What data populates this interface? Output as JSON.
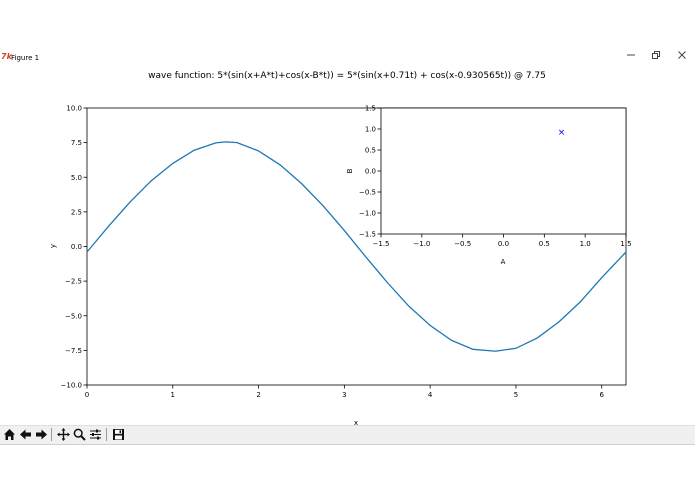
{
  "window": {
    "title": "Figure 1",
    "app_icon": "7k"
  },
  "main_chart": {
    "title": "wave function: 5*(sin(x+A*t)+cos(x-B*t)) = 5*(sin(x+0.71t) + cos(x-0.930565t)) @ 7.75",
    "xlabel": "x",
    "ylabel": "y",
    "x_ticks": [
      "0",
      "1",
      "2",
      "3",
      "4",
      "5",
      "6"
    ],
    "y_ticks": [
      "10.0",
      "7.5",
      "5.0",
      "2.5",
      "0.0",
      "−2.5",
      "−5.0",
      "−7.5",
      "−10.0"
    ]
  },
  "inset_chart": {
    "xlabel": "A",
    "ylabel": "B",
    "x_ticks": [
      "−1.5",
      "−1.0",
      "−0.5",
      "0.0",
      "0.5",
      "1.0",
      "1.5"
    ],
    "y_ticks": [
      "1.5",
      "1.0",
      "0.5",
      "0.0",
      "−0.5",
      "−1.0",
      "−1.5"
    ],
    "marker": "×"
  },
  "chart_data": [
    {
      "type": "line",
      "title": "wave function: 5*(sin(x+A*t)+cos(x-B*t)) = 5*(sin(x+0.71t) + cos(x-0.930565t)) @ 7.75",
      "xlabel": "x",
      "ylabel": "y",
      "xlim": [
        0,
        6.283
      ],
      "ylim": [
        -10,
        10
      ],
      "grid": false,
      "line_color": "#1f77b4",
      "x": [
        0.0,
        0.25,
        0.5,
        0.75,
        1.0,
        1.25,
        1.5,
        1.62,
        1.75,
        2.0,
        2.25,
        2.5,
        2.75,
        3.0,
        3.25,
        3.5,
        3.75,
        4.0,
        4.25,
        4.5,
        4.75,
        4.77,
        5.0,
        5.25,
        5.5,
        5.75,
        6.0,
        6.283
      ],
      "y": [
        -0.4,
        1.45,
        3.2,
        4.75,
        6.0,
        6.95,
        7.48,
        7.55,
        7.5,
        6.9,
        5.9,
        4.55,
        2.95,
        1.15,
        -0.75,
        -2.6,
        -4.3,
        -5.7,
        -6.78,
        -7.42,
        -7.55,
        -7.55,
        -7.35,
        -6.6,
        -5.45,
        -4.0,
        -2.25,
        -0.4
      ]
    },
    {
      "type": "scatter",
      "xlabel": "A",
      "ylabel": "B",
      "xlim": [
        -1.5,
        1.5
      ],
      "ylim": [
        -1.5,
        1.5
      ],
      "grid": false,
      "marker_color": "#0000ff",
      "x": [
        0.71
      ],
      "y": [
        0.930565
      ]
    }
  ],
  "toolbar": {
    "buttons": [
      {
        "name": "home-button",
        "icon": "home-icon"
      },
      {
        "name": "back-button",
        "icon": "arrow-left-icon"
      },
      {
        "name": "forward-button",
        "icon": "arrow-right-icon"
      },
      {
        "name": "pan-button",
        "icon": "move-icon"
      },
      {
        "name": "zoom-button",
        "icon": "zoom-icon"
      },
      {
        "name": "configure-subplots-button",
        "icon": "sliders-icon"
      },
      {
        "name": "save-button",
        "icon": "floppy-disk-icon"
      }
    ]
  }
}
